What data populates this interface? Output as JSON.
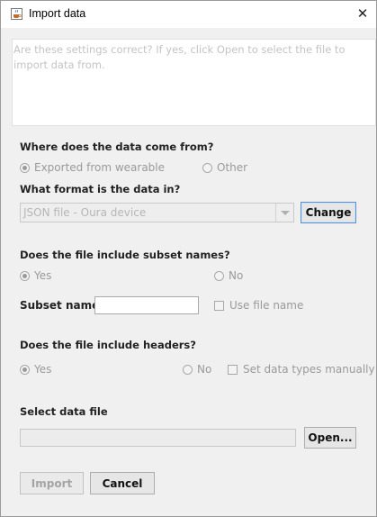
{
  "window": {
    "title": "Import data",
    "close_glyph": "✕",
    "icon": "java-cup-icon"
  },
  "message": "Are these settings correct? If yes, click Open to select the file to import data from.",
  "source_section": {
    "title": "Where does the data come from?",
    "options": [
      {
        "label": "Exported from wearable",
        "selected": true
      },
      {
        "label": "Other",
        "selected": false
      }
    ]
  },
  "format_section": {
    "title": "What format is the data in?",
    "selected_format": "JSON file - Oura device",
    "change_label": "Change"
  },
  "subset_section": {
    "title": "Does the file include subset names?",
    "options": [
      {
        "label": "Yes",
        "selected": true
      },
      {
        "label": "No",
        "selected": false
      }
    ],
    "subset_name_label": "Subset name",
    "subset_name_value": "",
    "use_file_name_label": "Use file name",
    "use_file_name_checked": false
  },
  "headers_section": {
    "title": "Does the file include headers?",
    "options": [
      {
        "label": "Yes",
        "selected": true
      },
      {
        "label": "No",
        "selected": false
      }
    ],
    "set_types_label": "Set data types manually",
    "set_types_checked": false
  },
  "file_section": {
    "title": "Select data file",
    "file_path": "",
    "open_label": "Open..."
  },
  "actions": {
    "import_label": "Import",
    "cancel_label": "Cancel"
  }
}
